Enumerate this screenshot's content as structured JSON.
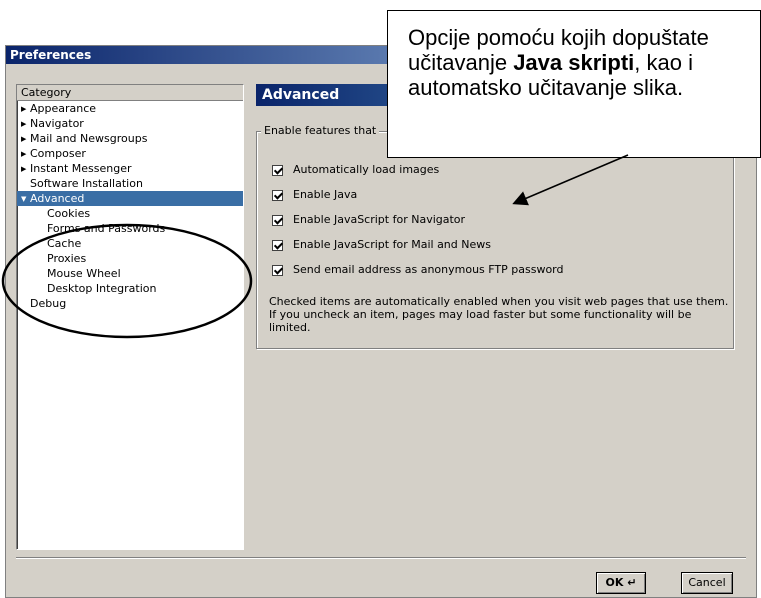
{
  "window": {
    "title": "Preferences"
  },
  "tree": {
    "header": "Category",
    "items": [
      {
        "label": "Appearance",
        "level": 0,
        "twisty": "collapsed"
      },
      {
        "label": "Navigator",
        "level": 0,
        "twisty": "collapsed"
      },
      {
        "label": "Mail and Newsgroups",
        "level": 0,
        "twisty": "collapsed"
      },
      {
        "label": "Composer",
        "level": 0,
        "twisty": "collapsed"
      },
      {
        "label": "Instant Messenger",
        "level": 0,
        "twisty": "collapsed"
      },
      {
        "label": "Software Installation",
        "level": 0,
        "twisty": "none"
      },
      {
        "label": "Advanced",
        "level": 0,
        "twisty": "expanded",
        "selected": true
      },
      {
        "label": "Cookies",
        "level": 1
      },
      {
        "label": "Forms and Passwords",
        "level": 1
      },
      {
        "label": "Cache",
        "level": 1
      },
      {
        "label": "Proxies",
        "level": 1
      },
      {
        "label": "Mouse Wheel",
        "level": 1
      },
      {
        "label": "Desktop Integration",
        "level": 1
      },
      {
        "label": "Debug",
        "level": 0,
        "twisty": "none"
      }
    ]
  },
  "panel": {
    "header": "Advanced",
    "group_label": "Enable features that",
    "checkboxes": [
      {
        "label": "Automatically load images",
        "checked": true
      },
      {
        "label": "Enable Java",
        "checked": true
      },
      {
        "label": "Enable JavaScript for Navigator",
        "checked": true
      },
      {
        "label": "Enable JavaScript for Mail and News",
        "checked": true
      },
      {
        "label": "Send email address as anonymous FTP password",
        "checked": true
      }
    ],
    "info": "Checked items are automatically enabled when you visit web pages that use them. If you uncheck an item, pages may load faster but some functionality will be limited."
  },
  "buttons": {
    "ok": "OK ↵",
    "cancel": "Cancel"
  },
  "callout": {
    "text_1": "Opcije pomoću kojih dopuštate učitavanje ",
    "bold_1": "Java skripti",
    "text_2": ", kao i automatsko učitavanje slika."
  },
  "colors": {
    "selection": "#3a6ea5",
    "titlebar": "#0a246a",
    "dialog": "#d4d0c8"
  }
}
